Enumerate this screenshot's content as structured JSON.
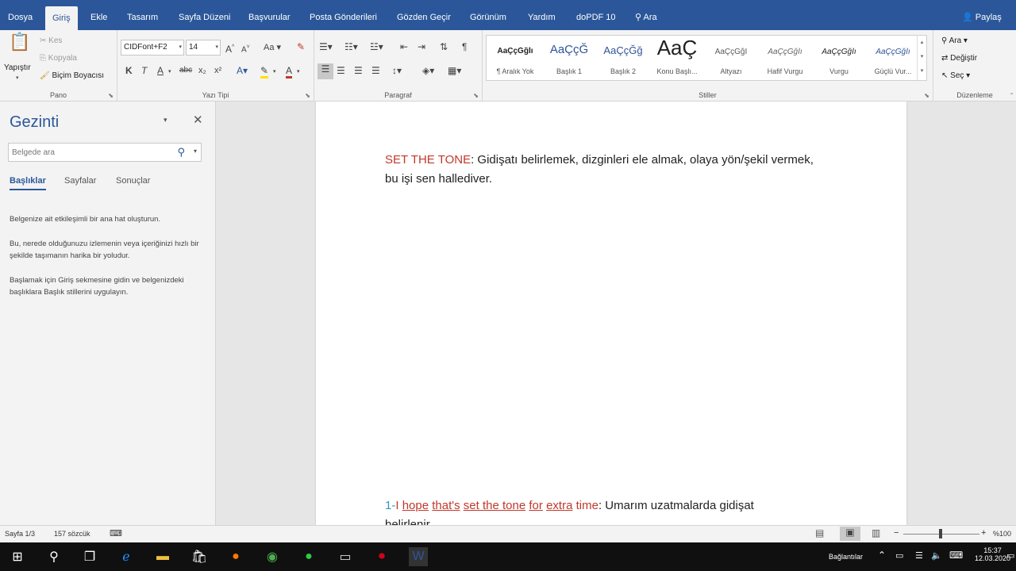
{
  "menu": {
    "tabs": [
      {
        "label": "Dosya"
      },
      {
        "label": "Giriş"
      },
      {
        "label": "Ekle"
      },
      {
        "label": "Tasarım"
      },
      {
        "label": "Sayfa Düzeni"
      },
      {
        "label": "Başvurular"
      },
      {
        "label": "Posta Gönderileri"
      },
      {
        "label": "Gözden Geçir"
      },
      {
        "label": "Görünüm"
      },
      {
        "label": "Yardım"
      },
      {
        "label": "doPDF 10"
      }
    ],
    "search_label": "Ara",
    "share_label": "Paylaş"
  },
  "ribbon": {
    "clipboard": {
      "paste": "Yapıştır",
      "cut": "Kes",
      "copy": "Kopyala",
      "format_painter": "Biçim Boyacısı",
      "group": "Pano"
    },
    "font": {
      "name": "CIDFont+F2",
      "size": "14",
      "case": "Aa",
      "group": "Yazı Tipi",
      "bold": "K",
      "italic": "T",
      "underline": "A"
    },
    "paragraph": {
      "group": "Paragraf"
    },
    "styles": {
      "group": "Stiller",
      "items": [
        {
          "sample": "AaÇçĞğİı",
          "name": "¶ Aralık Yok"
        },
        {
          "sample": "AaÇçĞ",
          "name": "Başlık 1"
        },
        {
          "sample": "AaÇçĞğ",
          "name": "Başlık 2"
        },
        {
          "sample": "AaÇ",
          "name": "Konu Başlı..."
        },
        {
          "sample": "AaÇçĞğİ",
          "name": "Altyazı"
        },
        {
          "sample": "AaÇçĞğİı",
          "name": "Hafif Vurgu"
        },
        {
          "sample": "AaÇçĞğİı",
          "name": "Vurgu"
        },
        {
          "sample": "AaÇçĞğİı",
          "name": "Güçlü Vur..."
        }
      ]
    },
    "editing": {
      "find": "Ara",
      "replace": "Değiştir",
      "select": "Seç",
      "group": "Düzenleme"
    }
  },
  "nav": {
    "title": "Gezinti",
    "search_placeholder": "Belgede ara",
    "tabs": [
      {
        "label": "Başlıklar"
      },
      {
        "label": "Sayfalar"
      },
      {
        "label": "Sonuçlar"
      }
    ],
    "p1": "Belgenize ait etkileşimli bir ana hat oluşturun.",
    "p2": "Bu, nerede olduğunuzu izlemenin veya içeriğinizi hızlı bir şekilde taşımanın harika bir yoludur.",
    "p3": "Başlamak için Giriş sekmesine gidin ve belgenizdeki başlıklara Başlık stillerini uygulayın."
  },
  "document": {
    "l1_term": "SET THE TONE",
    "l1_colon": ":",
    "l1_text": " Gidişatı belirlemek, dizginleri ele almak, olaya yön/şekil vermek,",
    "l2_text": "bu işi sen hallediver.",
    "ex_num": "1-",
    "ex_w1": "I",
    "ex_w2": "hope",
    "ex_w3": "that's",
    "ex_w4": "set the tone",
    "ex_w5": "for",
    "ex_w6": "extra",
    "ex_w7": "time",
    "ex_colon": ":",
    "ex_tr": " Umarım uzatmalarda gidişat",
    "ex_tr2": "belirlenir."
  },
  "status": {
    "page": "Sayfa 1/3",
    "words": "157 sözcük",
    "zoom": "%100"
  },
  "taskbar": {
    "connections": "Bağlantılar",
    "time": "15:37",
    "date": "12.03.2020"
  },
  "colors": {
    "accent": "#2b579a",
    "term_red": "#c0392b",
    "number_cyan": "#2e9bc0"
  }
}
